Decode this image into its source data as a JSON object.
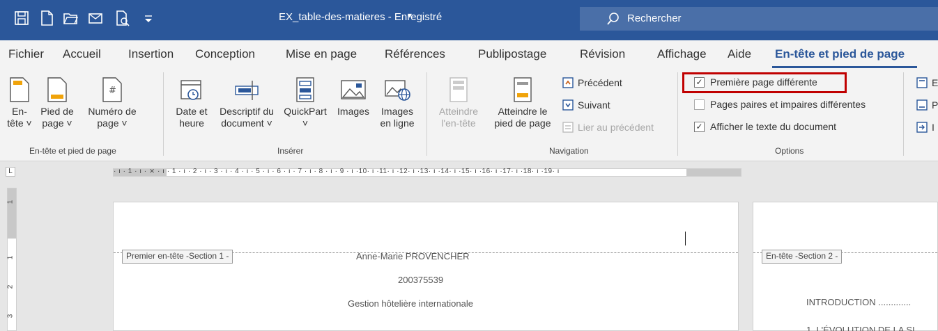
{
  "window": {
    "doc_title": "EX_table-des-matieres - Enregistré",
    "title_caret": "▾",
    "search_placeholder": "Rechercher"
  },
  "tabs": [
    {
      "label": "Fichier"
    },
    {
      "label": "Accueil"
    },
    {
      "label": "Insertion"
    },
    {
      "label": "Conception"
    },
    {
      "label": "Mise en page"
    },
    {
      "label": "Références"
    },
    {
      "label": "Publipostage"
    },
    {
      "label": "Révision"
    },
    {
      "label": "Affichage"
    },
    {
      "label": "Aide"
    },
    {
      "label": "En-tête et pied de page",
      "active": true
    }
  ],
  "ribbon": {
    "group_headerfooter": {
      "label": "En-tête et pied de page",
      "btn_header": "En-\ntête ˅",
      "btn_footer": "Pied de\npage ˅",
      "btn_pagenum": "Numéro de\npage ˅"
    },
    "group_insert": {
      "label": "Insérer",
      "btn_datetime": "Date et\nheure",
      "btn_docinfo": "Descriptif du\ndocument ˅",
      "btn_quickpart": "QuickPart\n˅",
      "btn_images": "Images",
      "btn_online_images": "Images\nen ligne"
    },
    "group_navigation": {
      "label": "Navigation",
      "btn_goto_header": "Atteindre\nl'en-tête",
      "btn_goto_footer": "Atteindre le\npied de page",
      "btn_previous": "Précédent",
      "btn_next": "Suivant",
      "btn_link_previous": "Lier au précédent"
    },
    "group_options": {
      "label": "Options",
      "opt_first_page": "Première page différente",
      "opt_first_page_checked": true,
      "opt_odd_even": "Pages paires et impaires différentes",
      "opt_odd_even_checked": false,
      "opt_show_text": "Afficher le texte du document",
      "opt_show_text_checked": true
    },
    "group_position_partial": {
      "items": [
        "E",
        "P",
        "I"
      ]
    }
  },
  "ruler": {
    "numbers": "· ı · 1 · ı · ⨯ · ı · 1 · ı · 2 · ı · 3 · ı · 4 · ı · 5 · ı · 6 · ı · 7 · ı · 8 · ı · 9 · ı ·10· ı ·11· ı ·12· ı ·13· ı ·14· ı ·15· ı ·16· ı ·17· ı ·18· ı ·19· ı"
  },
  "vruler": {
    "labels": [
      "1",
      "1",
      "2",
      "3"
    ]
  },
  "page1": {
    "header_tag": "Premier en-tête -Section 1 -",
    "author": "Anne-Marie PROVENCHER",
    "student_id": "200375539",
    "program": "Gestion hôtelière internationale"
  },
  "page2": {
    "header_tag": "En-tête -Section 2 -",
    "toc_line1": "INTRODUCTION .............",
    "toc_line2": "1.    L'ÉVOLUTION DE LA SI"
  },
  "colors": {
    "accent": "#2b579a",
    "highlight": "#c00000"
  }
}
